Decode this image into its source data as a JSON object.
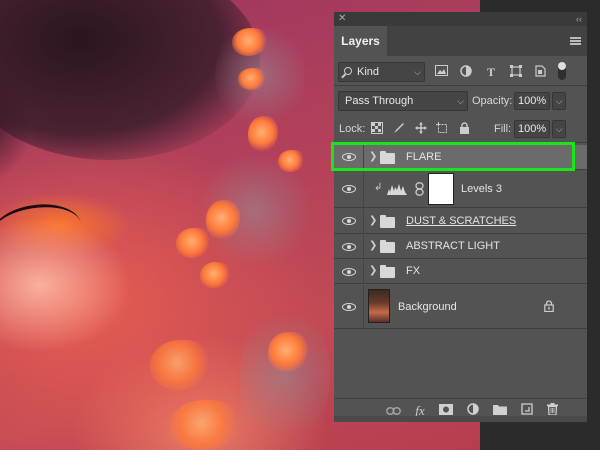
{
  "panel": {
    "close_glyph": "✕",
    "collapse_glyph": "‹‹",
    "tab_label": "Layers",
    "filter": {
      "kind_label": "Kind",
      "icons": [
        "image-filter-icon",
        "adjustment-filter-icon",
        "type-filter-icon",
        "shape-filter-icon",
        "smart-object-filter-icon"
      ]
    },
    "blend_mode": "Pass Through",
    "opacity_label": "Opacity:",
    "opacity_value": "100%",
    "lock_label": "Lock:",
    "fill_label": "Fill:",
    "fill_value": "100%",
    "layers": [
      {
        "name": "FLARE",
        "type": "group",
        "visible": true,
        "selected": true
      },
      {
        "name": "Levels 3",
        "type": "adjustment",
        "visible": true,
        "clipped": true
      },
      {
        "name": "DUST & SCRATCHES",
        "type": "group",
        "visible": true
      },
      {
        "name": "ABSTRACT LIGHT",
        "type": "group",
        "visible": true
      },
      {
        "name": "FX",
        "type": "group",
        "visible": true
      },
      {
        "name": "Background",
        "type": "image",
        "visible": true,
        "locked": true
      }
    ],
    "bottom_icons": [
      "link-layers-icon",
      "fx-icon",
      "add-mask-icon",
      "new-adjustment-icon",
      "new-group-icon",
      "new-layer-icon",
      "delete-icon"
    ],
    "fx_label": "fx"
  },
  "colors": {
    "highlight": "#19e619",
    "panel_bg": "#535353",
    "selected_row": "#6b6b6b"
  }
}
